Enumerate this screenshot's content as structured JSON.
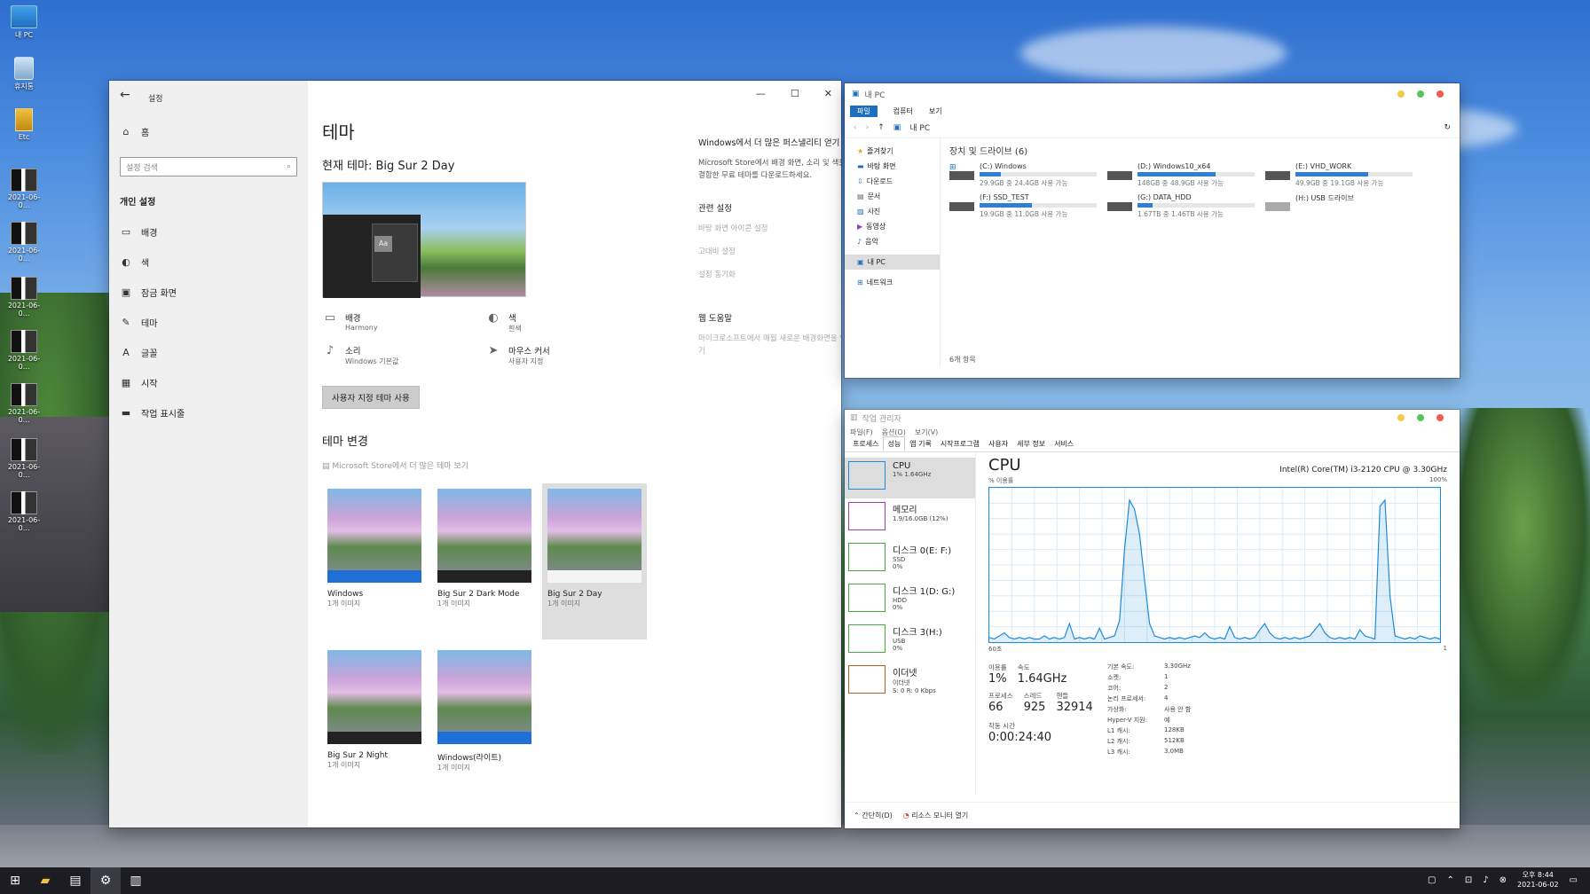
{
  "desktop": {
    "icons": [
      {
        "label": "내 PC"
      },
      {
        "label": "휴지통"
      },
      {
        "label": "Etc"
      },
      {
        "label": "2021-06-0..."
      },
      {
        "label": "2021-06-0..."
      },
      {
        "label": "2021-06-0..."
      },
      {
        "label": "2021-06-0..."
      },
      {
        "label": "2021-06-0..."
      },
      {
        "label": "2021-06-0..."
      },
      {
        "label": "2021-06-0..."
      }
    ]
  },
  "settings": {
    "app_title": "설정",
    "home": "홈",
    "search_placeholder": "설정 검색",
    "section": "개인 설정",
    "nav": [
      "배경",
      "색",
      "잠금 화면",
      "테마",
      "글꼴",
      "시작",
      "작업 표시줄"
    ],
    "page_title": "테마",
    "current_theme": "현재 테마: Big Sur 2 Day",
    "props": [
      {
        "title": "배경",
        "sub": "Harmony"
      },
      {
        "title": "색",
        "sub": "흰색"
      },
      {
        "title": "소리",
        "sub": "Windows 기본값"
      },
      {
        "title": "마우스 커서",
        "sub": "사용자 지정"
      }
    ],
    "save_button": "사용자 지정 테마 사용",
    "change_title": "테마 변경",
    "store_link": "Microsoft Store에서 더 많은 테마 보기",
    "themes": [
      {
        "name": "Windows",
        "count": "1개 이미지"
      },
      {
        "name": "Big Sur 2 Dark Mode",
        "count": "1개 이미지"
      },
      {
        "name": "Big Sur 2 Day",
        "count": "1개 이미지"
      },
      {
        "name": "Big Sur 2 Night",
        "count": "1개 이미지"
      },
      {
        "name": "Windows(라이트)",
        "count": "1개 이미지"
      }
    ],
    "right": {
      "more_title": "Windows에서 더 많은 퍼스낼리티 얻기",
      "more_text": "Microsoft Store에서 배경 화면, 소리 및 색을 결합한 무료 테마를 다운로드하세요.",
      "related_title": "관련 설정",
      "related": [
        "바탕 화면 아이콘 설정",
        "고대비 설정",
        "설정 동기화"
      ],
      "help_title": "웹 도움말",
      "help_link": "마이크로소프트에서 매월 새로운 배경화면을 얻기"
    }
  },
  "explorer": {
    "title": "내 PC",
    "ribbon": [
      "파일",
      "컴퓨터",
      "보기"
    ],
    "address": "내 PC",
    "nav": [
      "즐겨찾기",
      "바탕 화면",
      "다운로드",
      "문서",
      "사진",
      "동영상",
      "음악",
      "내 PC",
      "네트워크"
    ],
    "group": "장치 및 드라이브 (6)",
    "drives": [
      {
        "name": "(C:) Windows",
        "free": "29.9GB 중 24.4GB 사용 가능",
        "used": 0.18
      },
      {
        "name": "(D:) Windows10_x64",
        "free": "148GB 중 48.9GB 사용 가능",
        "used": 0.67
      },
      {
        "name": "(E:) VHD_WORK",
        "free": "49.9GB 중 19.1GB 사용 가능",
        "used": 0.62
      },
      {
        "name": "(F:) SSD_TEST",
        "free": "19.9GB 중 11.0GB 사용 가능",
        "used": 0.45
      },
      {
        "name": "(G:) DATA_HDD",
        "free": "1.67TB 중 1.46TB 사용 가능",
        "used": 0.13
      },
      {
        "name": "(H:) USB 드라이브",
        "free": "",
        "used": 0
      }
    ],
    "status": "6개 항목"
  },
  "taskmgr": {
    "title": "작업 관리자",
    "menu": [
      "파일(F)",
      "옵션(O)",
      "보기(V)"
    ],
    "tabs": [
      "프로세스",
      "성능",
      "앱 기록",
      "시작프로그램",
      "사용자",
      "세부 정보",
      "서비스"
    ],
    "resources": [
      {
        "name": "CPU",
        "sub": "1% 1.64GHz",
        "sub2": "",
        "sub3": "",
        "color": "#1f8ad8"
      },
      {
        "name": "메모리",
        "sub": "1.9/16.0GB (12%)",
        "sub2": "",
        "sub3": "",
        "color": "#a040b0"
      },
      {
        "name": "디스크 0(E: F:)",
        "sub": "SSD",
        "sub2": "0%",
        "sub3": "",
        "color": "#4aa84a"
      },
      {
        "name": "디스크 1(D: G:)",
        "sub": "HDD",
        "sub2": "0%",
        "sub3": "",
        "color": "#4aa84a"
      },
      {
        "name": "디스크 3(H:)",
        "sub": "USB",
        "sub2": "0%",
        "sub3": "",
        "color": "#4aa84a"
      },
      {
        "name": "이더넷",
        "sub": "이더넷",
        "sub2": "S: 0 R: 0 Kbps",
        "sub3": "",
        "color": "#b06020"
      }
    ],
    "cpu_title": "CPU",
    "cpu_model": "Intel(R) Core(TM) i3-2120 CPU @ 3.30GHz",
    "graph_label": "% 이용률",
    "graph_max": "100%",
    "axis_left": "60초",
    "axis_right": "1",
    "stats": {
      "util_label": "이용률",
      "util": "1%",
      "speed_label": "속도",
      "speed": "1.64GHz",
      "proc_label": "프로세스",
      "proc": "66",
      "thread_label": "스레드",
      "thread": "925",
      "handle_label": "핸들",
      "handle": "32914",
      "uptime_label": "작동 시간",
      "uptime": "0:00:24:40"
    },
    "kv": [
      [
        "기본 속도:",
        "3.30GHz"
      ],
      [
        "소켓:",
        "1"
      ],
      [
        "코어:",
        "2"
      ],
      [
        "논리 프로세서:",
        "4"
      ],
      [
        "가상화:",
        "사용 안 함"
      ],
      [
        "Hyper-V 지원:",
        "예"
      ],
      [
        "L1 캐시:",
        "128KB"
      ],
      [
        "L2 캐시:",
        "512KB"
      ],
      [
        "L3 캐시:",
        "3.0MB"
      ]
    ],
    "footer_simple": "간단히(D)",
    "footer_monitor": "리소스 모니터 열기",
    "cpu_series": [
      3,
      2,
      4,
      6,
      3,
      2,
      3,
      2,
      3,
      2,
      2,
      4,
      2,
      3,
      2,
      3,
      12,
      2,
      3,
      2,
      3,
      2,
      9,
      2,
      3,
      4,
      14,
      60,
      92,
      86,
      70,
      40,
      12,
      4,
      3,
      2,
      3,
      2,
      3,
      2,
      3,
      4,
      3,
      6,
      3,
      2,
      3,
      2,
      10,
      3,
      2,
      3,
      2,
      3,
      8,
      12,
      6,
      3,
      2,
      3,
      2,
      3,
      2,
      3,
      4,
      8,
      12,
      6,
      3,
      2,
      3,
      2,
      3,
      2,
      8,
      4,
      3,
      2,
      88,
      92,
      30,
      4,
      3,
      2,
      3,
      2,
      4,
      3,
      2,
      3,
      2
    ]
  },
  "taskbar": {
    "time": "오후 8:44",
    "date": "2021-06-02"
  },
  "colors": {
    "accent": "#1f6fc0",
    "cpu": "#1f8ad8"
  }
}
